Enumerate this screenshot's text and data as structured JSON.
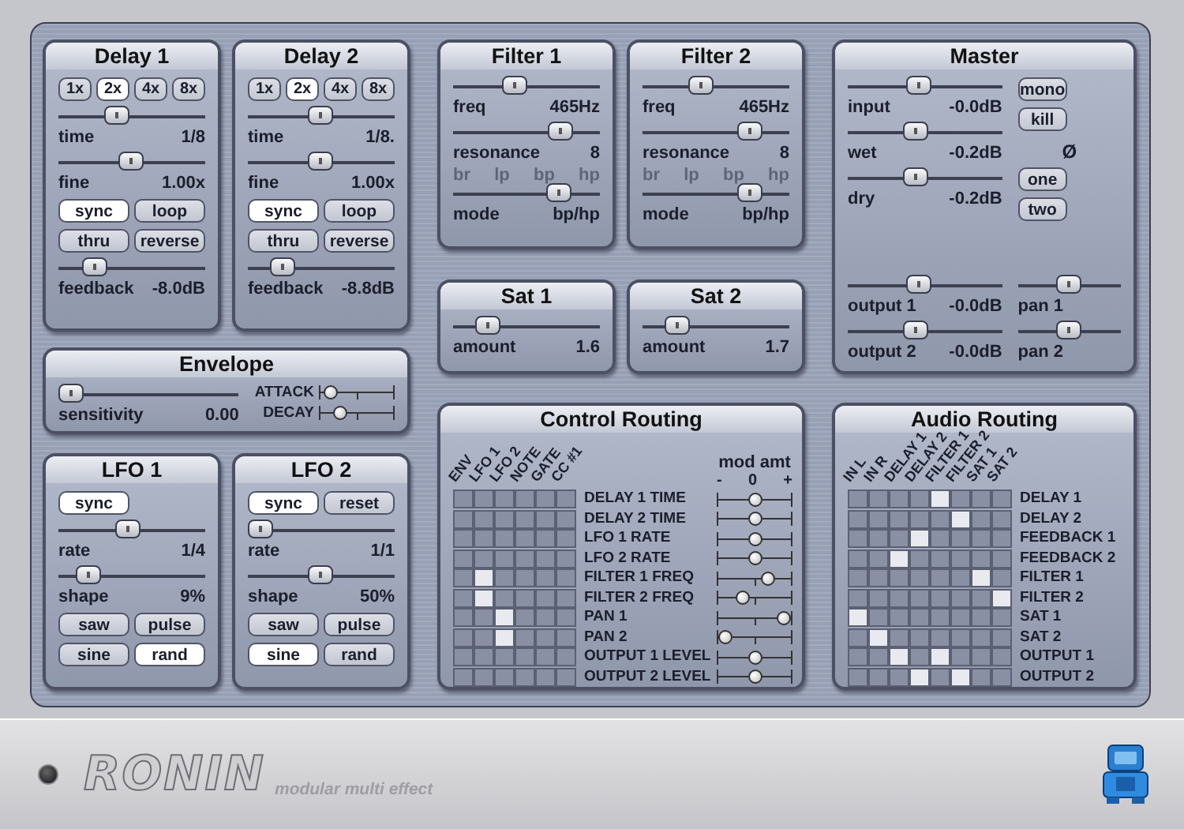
{
  "panels": [
    {
      "kind": "module",
      "title": "Delay 1",
      "rows": [
        {
          "kind": "buttons",
          "buttons": [
            {
              "label": "1x",
              "selected": false
            },
            {
              "label": "2x",
              "selected": true
            },
            {
              "label": "4x",
              "selected": false
            },
            {
              "label": "8x",
              "selected": false
            }
          ]
        },
        {
          "kind": "slider",
          "label": "time",
          "value": "1/8",
          "level": 0.38
        },
        {
          "kind": "slider",
          "label": "fine",
          "value": "1.00x",
          "level": 0.49
        },
        {
          "kind": "buttons",
          "buttons": [
            {
              "label": "sync",
              "selected": true
            },
            {
              "label": "loop",
              "selected": false
            }
          ]
        },
        {
          "kind": "buttons",
          "buttons": [
            {
              "label": "thru",
              "selected": false
            },
            {
              "label": "reverse",
              "selected": false
            }
          ]
        },
        {
          "kind": "slider",
          "label": "feedback",
          "value": "-8.0dB",
          "level": 0.2
        }
      ]
    },
    {
      "kind": "module",
      "title": "Delay 2",
      "rows": [
        {
          "kind": "buttons",
          "buttons": [
            {
              "label": "1x",
              "selected": false
            },
            {
              "label": "2x",
              "selected": true
            },
            {
              "label": "4x",
              "selected": false
            },
            {
              "label": "8x",
              "selected": false
            }
          ]
        },
        {
          "kind": "slider",
          "label": "time",
          "value": "1/8.",
          "level": 0.49
        },
        {
          "kind": "slider",
          "label": "fine",
          "value": "1.00x",
          "level": 0.49
        },
        {
          "kind": "buttons",
          "buttons": [
            {
              "label": "sync",
              "selected": true
            },
            {
              "label": "loop",
              "selected": false
            }
          ]
        },
        {
          "kind": "buttons",
          "buttons": [
            {
              "label": "thru",
              "selected": false
            },
            {
              "label": "reverse",
              "selected": false
            }
          ]
        },
        {
          "kind": "slider",
          "label": "feedback",
          "value": "-8.8dB",
          "level": 0.18
        }
      ]
    },
    {
      "kind": "module",
      "title": "Envelope",
      "rows": [
        {
          "kind": "columns",
          "columns": [
            [
              {
                "kind": "slider",
                "label": "sensitivity",
                "value": "0.00",
                "level": 0
              }
            ],
            [
              {
                "kind": "mini_slider",
                "label": "ATTACK",
                "level": 0.05
              },
              {
                "kind": "mini_slider",
                "label": "DECAY",
                "level": 0.22
              }
            ]
          ]
        }
      ]
    },
    {
      "kind": "module",
      "title": "LFO 1",
      "rows": [
        {
          "kind": "buttons",
          "buttons": [
            {
              "label": "sync",
              "selected": true
            }
          ]
        },
        {
          "kind": "slider",
          "label": "rate",
          "value": "1/4",
          "level": 0.47
        },
        {
          "kind": "slider",
          "label": "shape",
          "value": "9%",
          "level": 0.14
        },
        {
          "kind": "buttons",
          "buttons": [
            {
              "label": "saw",
              "selected": false
            },
            {
              "label": "pulse",
              "selected": false
            }
          ]
        },
        {
          "kind": "buttons",
          "buttons": [
            {
              "label": "sine",
              "selected": false
            },
            {
              "label": "rand",
              "selected": true
            }
          ]
        }
      ]
    },
    {
      "kind": "module",
      "title": "LFO 2",
      "rows": [
        {
          "kind": "buttons",
          "buttons": [
            {
              "label": "sync",
              "selected": true
            },
            {
              "label": "reset",
              "selected": false
            }
          ]
        },
        {
          "kind": "slider",
          "label": "rate",
          "value": "1/1",
          "level": 0
        },
        {
          "kind": "slider",
          "label": "shape",
          "value": "50%",
          "level": 0.49
        },
        {
          "kind": "buttons",
          "buttons": [
            {
              "label": "saw",
              "selected": false
            },
            {
              "label": "pulse",
              "selected": false
            }
          ]
        },
        {
          "kind": "buttons",
          "buttons": [
            {
              "label": "sine",
              "selected": true
            },
            {
              "label": "rand",
              "selected": false
            }
          ]
        }
      ]
    },
    {
      "kind": "module",
      "title": "Filter 1",
      "rows": [
        {
          "kind": "slider",
          "label": "freq",
          "value": "465Hz",
          "level": 0.4
        },
        {
          "kind": "slider",
          "label": "resonance",
          "value": "8",
          "level": 0.78
        },
        {
          "kind": "ticks",
          "labels": [
            "br",
            "lp",
            "bp",
            "hp"
          ]
        },
        {
          "kind": "slider",
          "label": "mode",
          "value": "bp/hp",
          "level": 0.77
        }
      ]
    },
    {
      "kind": "module",
      "title": "Filter 2",
      "rows": [
        {
          "kind": "slider",
          "label": "freq",
          "value": "465Hz",
          "level": 0.38
        },
        {
          "kind": "slider",
          "label": "resonance",
          "value": "8",
          "level": 0.78
        },
        {
          "kind": "ticks",
          "labels": [
            "br",
            "lp",
            "bp",
            "hp"
          ]
        },
        {
          "kind": "slider",
          "label": "mode",
          "value": "bp/hp",
          "level": 0.78
        }
      ]
    },
    {
      "kind": "module",
      "title": "Sat 1",
      "rows": [
        {
          "kind": "slider",
          "label": "amount",
          "value": "1.6",
          "level": 0.18
        }
      ]
    },
    {
      "kind": "module",
      "title": "Sat 2",
      "rows": [
        {
          "kind": "slider",
          "label": "amount",
          "value": "1.7",
          "level": 0.18
        }
      ]
    },
    {
      "kind": "matrix",
      "title": "Control Routing",
      "columns": [
        "ENV",
        "LFO 1",
        "LFO 2",
        "NOTE",
        "GATE",
        "CC #1"
      ],
      "mod_header": "mod amt",
      "mod_scale": [
        "-",
        "0",
        "+"
      ],
      "rows": [
        {
          "label": "DELAY 1 TIME",
          "cells": [
            false,
            false,
            false,
            false,
            false,
            false
          ],
          "level": 0.5
        },
        {
          "label": "DELAY 2 TIME",
          "cells": [
            false,
            false,
            false,
            false,
            false,
            false
          ],
          "level": 0.5
        },
        {
          "label": "LFO 1 RATE",
          "cells": [
            false,
            false,
            false,
            false,
            false,
            false
          ],
          "level": 0.5
        },
        {
          "label": "LFO 2 RATE",
          "cells": [
            false,
            false,
            false,
            false,
            false,
            false
          ],
          "level": 0.5
        },
        {
          "label": "FILTER 1 FREQ",
          "cells": [
            false,
            true,
            false,
            false,
            false,
            false
          ],
          "level": 0.72
        },
        {
          "label": "FILTER 2 FREQ",
          "cells": [
            false,
            true,
            false,
            false,
            false,
            false
          ],
          "level": 0.3
        },
        {
          "label": "PAN 1",
          "cells": [
            false,
            false,
            true,
            false,
            false,
            false
          ],
          "level": 1
        },
        {
          "label": "PAN 2",
          "cells": [
            false,
            false,
            true,
            false,
            false,
            false
          ],
          "level": 0
        },
        {
          "label": "OUTPUT 1 LEVEL",
          "cells": [
            false,
            false,
            false,
            false,
            false,
            false
          ],
          "level": 0.5
        },
        {
          "label": "OUTPUT 2 LEVEL",
          "cells": [
            false,
            false,
            false,
            false,
            false,
            false
          ],
          "level": 0.5
        }
      ]
    },
    {
      "kind": "module",
      "title": "Master",
      "rows": [
        {
          "kind": "columns",
          "columns": [
            [
              {
                "kind": "slider",
                "label": "input",
                "value": "-0.0dB",
                "level": 0.45
              },
              {
                "kind": "slider",
                "label": "wet",
                "value": "-0.2dB",
                "level": 0.43
              },
              {
                "kind": "slider",
                "label": "dry",
                "value": "-0.2dB",
                "level": 0.43
              }
            ],
            [
              {
                "kind": "buttons",
                "buttons": [
                  {
                    "label": "mono",
                    "selected": false
                  }
                ]
              },
              {
                "kind": "buttons",
                "buttons": [
                  {
                    "label": "kill",
                    "selected": false
                  }
                ]
              },
              {
                "kind": "label",
                "text": "Ø"
              },
              {
                "kind": "buttons",
                "buttons": [
                  {
                    "label": "one",
                    "selected": false
                  }
                ]
              },
              {
                "kind": "buttons",
                "buttons": [
                  {
                    "label": "two",
                    "selected": false
                  }
                ]
              }
            ]
          ]
        },
        {
          "kind": "columns",
          "columns": [
            [
              {
                "kind": "slider",
                "label": "output 1",
                "value": "-0.0dB",
                "level": 0.45
              },
              {
                "kind": "slider",
                "label": "output 2",
                "value": "-0.0dB",
                "level": 0.43
              }
            ],
            [
              {
                "kind": "slider",
                "label": "pan 1",
                "level": 0.5
              },
              {
                "kind": "slider",
                "label": "pan 2",
                "level": 0.5
              }
            ]
          ]
        }
      ]
    },
    {
      "kind": "matrix",
      "title": "Audio Routing",
      "columns": [
        "IN L",
        "IN R",
        "DELAY 1",
        "DELAY 2",
        "FILTER 1",
        "FILTER 2",
        "SAT 1",
        "SAT 2"
      ],
      "rows": [
        {
          "label": "DELAY 1",
          "cells": [
            false,
            false,
            false,
            false,
            true,
            false,
            false,
            false
          ]
        },
        {
          "label": "DELAY 2",
          "cells": [
            false,
            false,
            false,
            false,
            false,
            true,
            false,
            false
          ]
        },
        {
          "label": "FEEDBACK 1",
          "cells": [
            false,
            false,
            false,
            true,
            false,
            false,
            false,
            false
          ]
        },
        {
          "label": "FEEDBACK 2",
          "cells": [
            false,
            false,
            true,
            false,
            false,
            false,
            false,
            false
          ]
        },
        {
          "label": "FILTER 1",
          "cells": [
            false,
            false,
            false,
            false,
            false,
            false,
            true,
            false
          ]
        },
        {
          "label": "FILTER 2",
          "cells": [
            false,
            false,
            false,
            false,
            false,
            false,
            false,
            true
          ]
        },
        {
          "label": "SAT 1",
          "cells": [
            true,
            false,
            false,
            false,
            false,
            false,
            false,
            false
          ]
        },
        {
          "label": "SAT 2",
          "cells": [
            false,
            true,
            false,
            false,
            false,
            false,
            false,
            false
          ]
        },
        {
          "label": "OUTPUT 1",
          "cells": [
            false,
            false,
            true,
            false,
            true,
            false,
            false,
            false
          ]
        },
        {
          "label": "OUTPUT 2",
          "cells": [
            false,
            false,
            false,
            true,
            false,
            true,
            false,
            false
          ]
        }
      ]
    }
  ],
  "footer": {
    "logo": "RONIN",
    "tagline": "modular multi effect"
  }
}
